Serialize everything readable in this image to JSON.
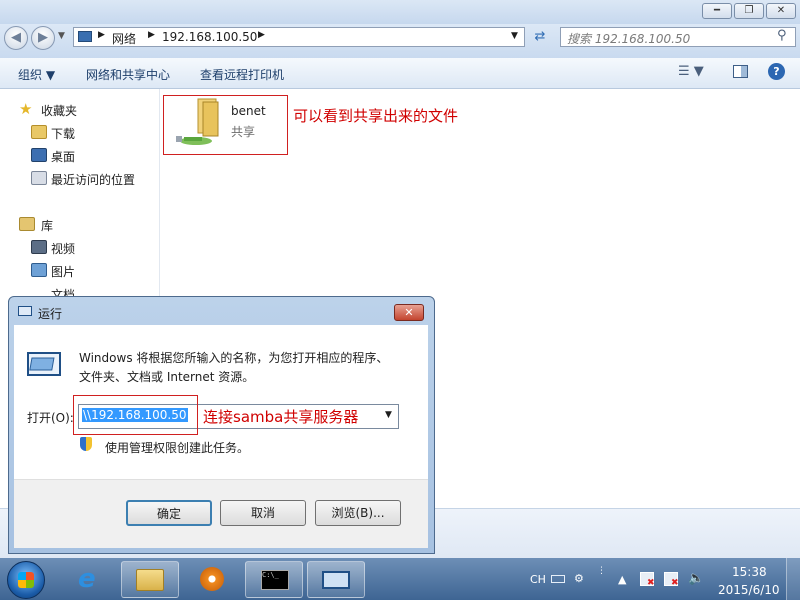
{
  "explorer": {
    "breadcrumb": [
      "网络",
      "192.168.100.50"
    ],
    "search_placeholder": "搜索 192.168.100.50",
    "toolbar": {
      "organize": "组织 ▼",
      "network_center": "网络和共享中心",
      "remote_printers": "查看远程打印机"
    },
    "nav": {
      "favorites": "收藏夹",
      "downloads": "下载",
      "desktop": "桌面",
      "recent": "最近访问的位置",
      "libraries": "库",
      "videos": "视频",
      "pictures": "图片",
      "documents": "文档"
    },
    "items": [
      {
        "name": "benet",
        "type": "共享"
      }
    ]
  },
  "annotations": {
    "share": "可以看到共享出来的文件",
    "connect": "连接samba共享服务器"
  },
  "run_dialog": {
    "title": "运行",
    "description_line1": "Windows 将根据您所输入的名称，为您打开相应的程序、",
    "description_line2": "文件夹、文档或 Internet 资源。",
    "open_label": "打开(O):",
    "open_value": "\\\\192.168.100.50",
    "admin_note": "使用管理权限创建此任务。",
    "ok": "确定",
    "cancel": "取消",
    "browse": "浏览(B)..."
  },
  "taskbar": {
    "lang": "CH",
    "time": "15:38",
    "date": "2015/6/10"
  },
  "colors": {
    "annotation": "#d00000",
    "selection": "#3399ff",
    "taskbar": "#4f76a4"
  }
}
